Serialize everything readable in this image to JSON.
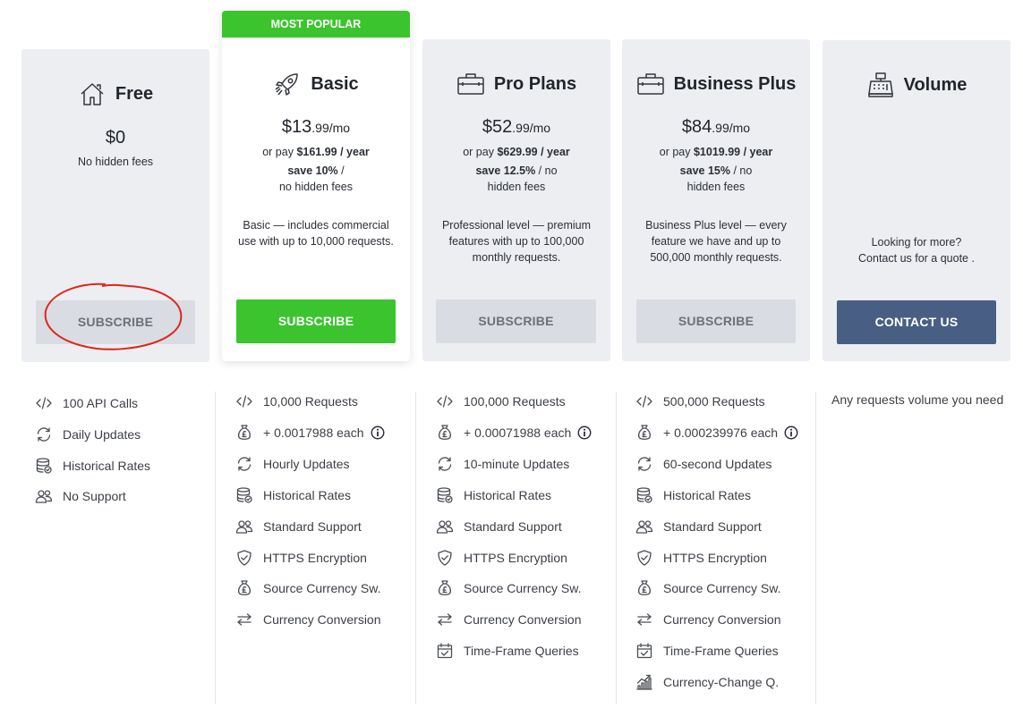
{
  "plans": [
    {
      "name": "Free",
      "icon": "house-icon",
      "price_dollars": "$0",
      "price_cents": "",
      "fees_note": "No hidden fees",
      "button_label": "SUBSCRIBE"
    },
    {
      "badge": "MOST POPULAR",
      "name": "Basic",
      "icon": "rocket-icon",
      "price_dollars": "$13",
      "price_cents": ".99/mo",
      "yearly_prefix": "or pay ",
      "yearly_price": "$161.99 / year",
      "save_pct": "save 10%",
      "save_suffix": " /",
      "save_line2": "no hidden fees",
      "description": "Basic — includes commercial use with up to 10,000 requests.",
      "button_label": "SUBSCRIBE"
    },
    {
      "name": "Pro Plans",
      "icon": "briefcase-icon",
      "price_dollars": "$52",
      "price_cents": ".99/mo",
      "yearly_prefix": "or pay ",
      "yearly_price": "$629.99 / year",
      "save_pct": "save 12.5%",
      "save_suffix": " / no",
      "save_line2": "hidden fees",
      "description": "Professional level — premium features with up to 100,000 monthly requests.",
      "button_label": "SUBSCRIBE"
    },
    {
      "name": "Business Plus",
      "icon": "briefcase-icon",
      "price_dollars": "$84",
      "price_cents": ".99/mo",
      "yearly_prefix": "or pay ",
      "yearly_price": "$1019.99 / year",
      "save_pct": "save 15%",
      "save_suffix": " / no",
      "save_line2": "hidden fees",
      "description": "Business Plus level — every feature we have and up to 500,000 monthly requests.",
      "button_label": "SUBSCRIBE"
    },
    {
      "name": "Volume",
      "icon": "cash-register-icon",
      "contact_line1": "Looking for more?",
      "contact_line2": "Contact us for a quote .",
      "button_label": "CONTACT US"
    }
  ],
  "features": {
    "free": [
      "100 API Calls",
      "Daily Updates",
      "Historical Rates",
      "No Support"
    ],
    "basic": [
      "10,000 Requests",
      "+ 0.0017988 each",
      "Hourly Updates",
      "Historical Rates",
      "Standard Support",
      "HTTPS Encryption",
      "Source Currency Sw.",
      "Currency Conversion"
    ],
    "pro": [
      "100,000 Requests",
      "+ 0.00071988 each",
      "10-minute Updates",
      "Historical Rates",
      "Standard Support",
      "HTTPS Encryption",
      "Source Currency Sw.",
      "Currency Conversion",
      "Time-Frame Queries"
    ],
    "business": [
      "500,000 Requests",
      "+ 0.000239976 each",
      "60-second Updates",
      "Historical Rates",
      "Standard Support",
      "HTTPS Encryption",
      "Source Currency Sw.",
      "Currency Conversion",
      "Time-Frame Queries",
      "Currency-Change Q."
    ],
    "volume": "Any requests volume you need"
  },
  "colors": {
    "accent_green": "#3bc42e",
    "navy_button": "#485f83",
    "card_bg": "#eceef2",
    "annotation_red": "#e0241b"
  }
}
